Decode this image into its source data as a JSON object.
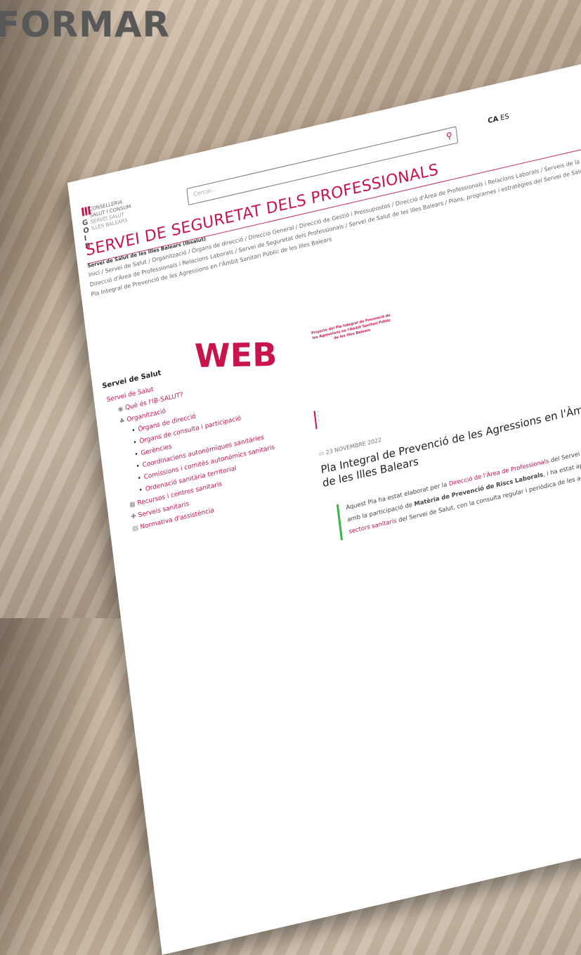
{
  "banner": "FORMAR",
  "overlay_word": "WEB",
  "logo": {
    "letters": [
      "G",
      "O",
      "I",
      "B"
    ],
    "lines": [
      "CONSELLERIA",
      "SALUT I CONSUM",
      "SERVEI SALUT",
      "ILLES BALEARS"
    ]
  },
  "search": {
    "placeholder": "Cercar..."
  },
  "languages": {
    "active": "CA",
    "other": "ES"
  },
  "page_title": "SERVEI DE SEGURETAT DELS PROFESSIONALS",
  "subtitle": "Servei de Salut de les Illes Balears (Ibsalut)",
  "breadcrumbs": "Inici / Servei de Salut / Organització / Òrgans de direcció / Direcció General / Direcció de Gestió i Pressupostos / Direcció d'Àrea de Professionals i Relacions Laborals / Serveis de la Direcció d'Àrea de Professionals i Relacions Laborals / Servei de Seguretat dels Professionals / Servei de Salut de les Illes Balears / Plans, programes i estratègies del Servei de Salut / Pla Integral de Prevenció de les Agressions en l'Àmbit Sanitari Públic de les Illes Balears",
  "sidebar": {
    "heading": "Servei de Salut",
    "root": "Servei de Salut",
    "items": [
      {
        "label": "Què és l'IB-SALUT?",
        "level": 1
      },
      {
        "label": "Organització",
        "level": 1
      },
      {
        "label": "Òrgans de direcció",
        "level": 2
      },
      {
        "label": "Òrgans de consulta i participació",
        "level": 2
      },
      {
        "label": "Gerències",
        "level": 2
      },
      {
        "label": "Coordinacions autonòmiques sanitàries",
        "level": 2
      },
      {
        "label": "Comissions i comitès autonòmics sanitaris",
        "level": 2
      },
      {
        "label": "Ordenació sanitària territorial",
        "level": 2
      },
      {
        "label": "Recursos i centres sanitaris",
        "level": 1
      },
      {
        "label": "Serveis sanitaris",
        "level": 1
      },
      {
        "label": "Normativa d'assistència",
        "level": 1
      }
    ]
  },
  "project_caption": "Projecte del Pla Integral de Prevenció de les Agressions en l'Àmbit Sanitari Públic de les Illes Balears",
  "article": {
    "date": "23 NOVEMBRE 2022",
    "title": "Pla Integral de Prevenció de les Agressions en l'Àmbit Sanitari Públic de les Illes Balears",
    "p1": "Aquest Pla ha estat elaborat per la ",
    "p1_link": "Direcció de l'Àrea de Professionals",
    "p2": " del Servei de Salut de les Illes Balears amb la participació de ",
    "p3_bold": "Matèria de Prevenció de Riscs Laborals",
    "p4": ", i ha estat aprovat per cadascun dels ",
    "p4_link": "sectors sanitaris",
    "p5": " del Servei de Salut, con la consulta regular i periòdica de les actuacions."
  },
  "colors": {
    "accent": "#c8144a",
    "quote_bar": "#3ab54a"
  }
}
